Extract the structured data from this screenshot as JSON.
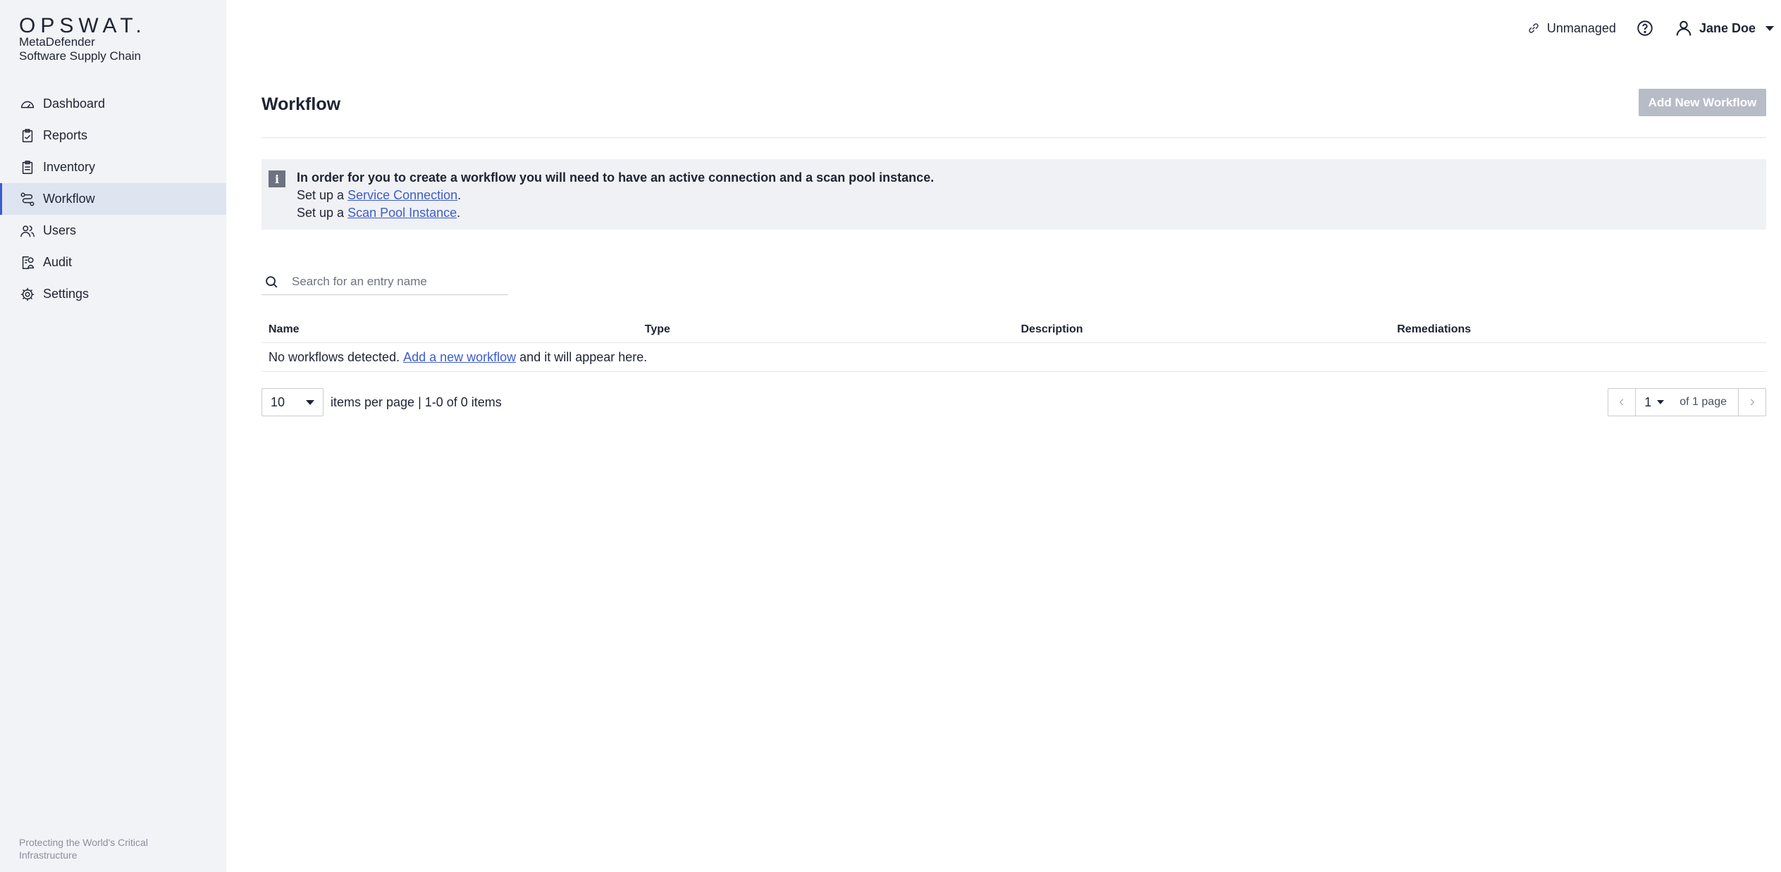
{
  "brand": {
    "logo": "OPSWAT.",
    "product_line1": "MetaDefender",
    "product_line2": "Software Supply Chain",
    "footer": "Protecting the World's Critical Infrastructure"
  },
  "sidebar": {
    "items": [
      {
        "label": "Dashboard",
        "icon": "dashboard-icon"
      },
      {
        "label": "Reports",
        "icon": "reports-icon"
      },
      {
        "label": "Inventory",
        "icon": "inventory-icon"
      },
      {
        "label": "Workflow",
        "icon": "workflow-icon",
        "active": true
      },
      {
        "label": "Users",
        "icon": "users-icon"
      },
      {
        "label": "Audit",
        "icon": "audit-icon"
      },
      {
        "label": "Settings",
        "icon": "settings-icon"
      }
    ]
  },
  "topbar": {
    "status": "Unmanaged",
    "username": "Jane Doe"
  },
  "page": {
    "title": "Workflow",
    "add_button": "Add New Workflow"
  },
  "alert": {
    "heading": "In order for you to create a workflow you will need to have an active connection and a scan pool instance.",
    "line1_prefix": "Set up a ",
    "line1_link": "Service Connection",
    "line1_suffix": ".",
    "line2_prefix": "Set up a ",
    "line2_link": "Scan Pool Instance",
    "line2_suffix": "."
  },
  "search": {
    "placeholder": "Search for an entry name"
  },
  "table": {
    "columns": [
      "Name",
      "Type",
      "Description",
      "Remediations"
    ],
    "empty_prefix": "No workflows detected. ",
    "empty_link": "Add a new workflow",
    "empty_suffix": " and it will appear here."
  },
  "pagination": {
    "per_page": "10",
    "summary": "items per page | 1-0 of 0 items",
    "current_page": "1",
    "of_pages": "of 1 page"
  },
  "colors": {
    "accent": "#3d5ccc",
    "sidebar_bg": "#f1f3f7",
    "active_bg": "#dfe4f1",
    "disabled_button": "#b8bcc6"
  }
}
